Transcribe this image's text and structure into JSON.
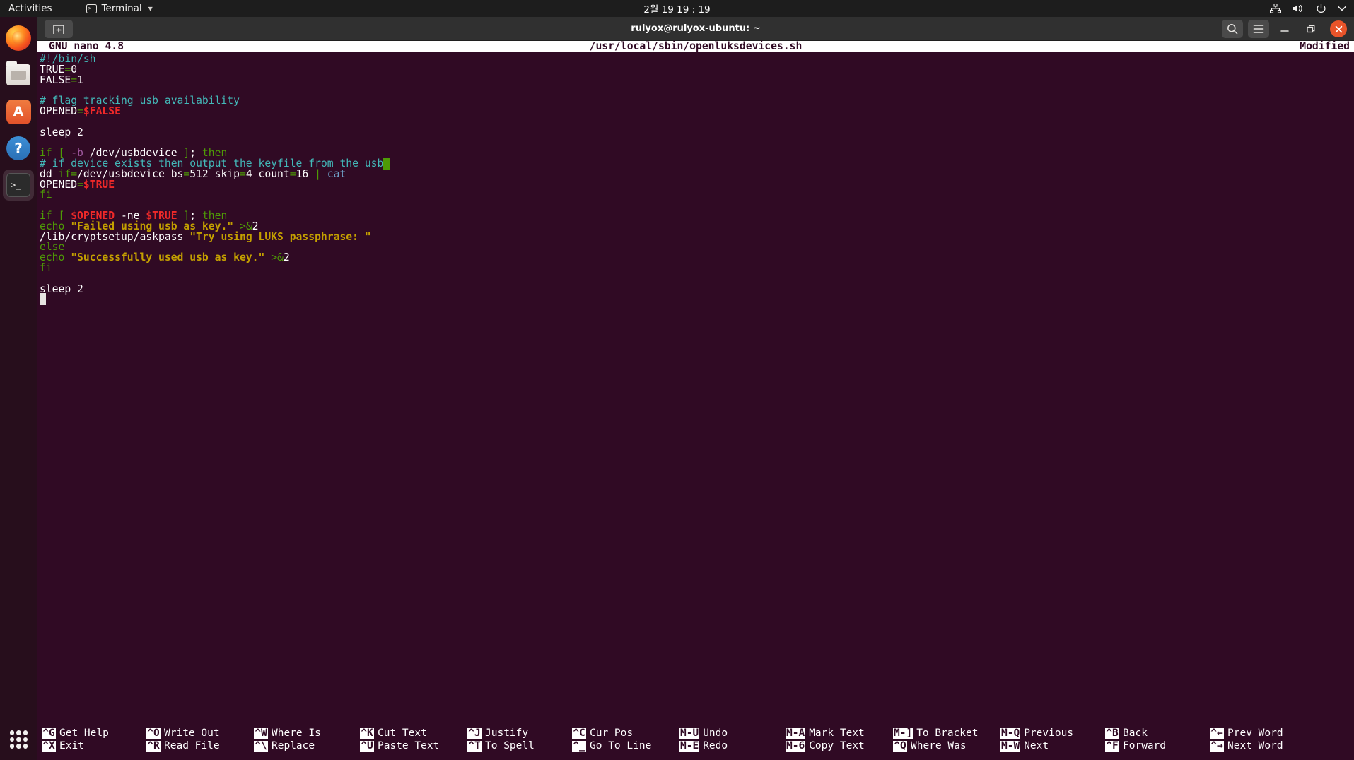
{
  "topbar": {
    "activities": "Activities",
    "app_name": "Terminal",
    "app_icon": "terminal-icon",
    "clock": "2월 19  19 : 19",
    "indicators": [
      "network-icon",
      "volume-icon",
      "power-icon",
      "chevron-down-icon"
    ]
  },
  "dock": {
    "items": [
      {
        "name": "firefox",
        "label": "Firefox"
      },
      {
        "name": "files",
        "label": "Files"
      },
      {
        "name": "software",
        "label": "Ubuntu Software"
      },
      {
        "name": "help",
        "label": "Help"
      },
      {
        "name": "terminal",
        "label": "Terminal"
      }
    ],
    "show_apps": "Show Applications"
  },
  "window": {
    "title": "rulyox@rulyox-ubuntu: ~",
    "new_tab_icon": "new-tab-icon",
    "controls": {
      "search": "search-icon",
      "menu": "hamburger-menu-icon",
      "minimize": "minimize-icon",
      "maximize": "maximize-icon",
      "close": "close-icon"
    }
  },
  "nano": {
    "version": "GNU nano 4.8",
    "filepath": "/usr/local/sbin/openluksdevices.sh",
    "status": "Modified",
    "lines": [
      [
        {
          "t": "#!/bin/sh",
          "c": "cmt"
        }
      ],
      [
        {
          "t": "TRUE",
          "c": "wht"
        },
        {
          "t": "=",
          "c": "eq"
        },
        {
          "t": "0",
          "c": "wht"
        }
      ],
      [
        {
          "t": "FALSE",
          "c": "wht"
        },
        {
          "t": "=",
          "c": "eq"
        },
        {
          "t": "1",
          "c": "wht"
        }
      ],
      [],
      [
        {
          "t": "# flag tracking usb availability",
          "c": "cmt"
        }
      ],
      [
        {
          "t": "OPENED",
          "c": "wht"
        },
        {
          "t": "=",
          "c": "eq"
        },
        {
          "t": "$FALSE",
          "c": "red"
        }
      ],
      [],
      [
        {
          "t": "sleep 2",
          "c": "wht"
        }
      ],
      [],
      [
        {
          "t": "if",
          "c": "grn"
        },
        {
          "t": " ",
          "c": "wht"
        },
        {
          "t": "[",
          "c": "grn"
        },
        {
          "t": " ",
          "c": "wht"
        },
        {
          "t": "-b",
          "c": "pur"
        },
        {
          "t": " /dev/usbdevice ",
          "c": "wht"
        },
        {
          "t": "]",
          "c": "grn"
        },
        {
          "t": "; ",
          "c": "wht"
        },
        {
          "t": "then",
          "c": "grn"
        }
      ],
      [
        {
          "t": "# if device exists then output the keyfile from the usb",
          "c": "cmt"
        },
        {
          "t": " ",
          "c": "cur-grn"
        }
      ],
      [
        {
          "t": "dd ",
          "c": "wht"
        },
        {
          "t": "if",
          "c": "grn"
        },
        {
          "t": "=",
          "c": "eq"
        },
        {
          "t": "/dev/usbdevice bs",
          "c": "wht"
        },
        {
          "t": "=",
          "c": "eq"
        },
        {
          "t": "512 skip",
          "c": "wht"
        },
        {
          "t": "=",
          "c": "eq"
        },
        {
          "t": "4 count",
          "c": "wht"
        },
        {
          "t": "=",
          "c": "eq"
        },
        {
          "t": "16 ",
          "c": "wht"
        },
        {
          "t": "|",
          "c": "grn"
        },
        {
          "t": " ",
          "c": "wht"
        },
        {
          "t": "cat",
          "c": "cyn"
        }
      ],
      [
        {
          "t": "OPENED",
          "c": "wht"
        },
        {
          "t": "=",
          "c": "eq"
        },
        {
          "t": "$TRUE",
          "c": "red"
        }
      ],
      [
        {
          "t": "fi",
          "c": "grn"
        }
      ],
      [],
      [
        {
          "t": "if",
          "c": "grn"
        },
        {
          "t": " ",
          "c": "wht"
        },
        {
          "t": "[",
          "c": "grn"
        },
        {
          "t": " ",
          "c": "wht"
        },
        {
          "t": "$OPENED",
          "c": "red"
        },
        {
          "t": " -ne ",
          "c": "wht"
        },
        {
          "t": "$TRUE",
          "c": "red"
        },
        {
          "t": " ",
          "c": "wht"
        },
        {
          "t": "]",
          "c": "grn"
        },
        {
          "t": "; ",
          "c": "wht"
        },
        {
          "t": "then",
          "c": "grn"
        }
      ],
      [
        {
          "t": "echo",
          "c": "grn"
        },
        {
          "t": " ",
          "c": "wht"
        },
        {
          "t": "\"Failed using usb as key.\"",
          "c": "yel"
        },
        {
          "t": " ",
          "c": "wht"
        },
        {
          "t": ">&",
          "c": "grn"
        },
        {
          "t": "2",
          "c": "wht"
        }
      ],
      [
        {
          "t": "/lib/cryptsetup/askpass ",
          "c": "wht"
        },
        {
          "t": "\"Try using LUKS passphrase: \"",
          "c": "yel"
        }
      ],
      [
        {
          "t": "else",
          "c": "grn"
        }
      ],
      [
        {
          "t": "echo",
          "c": "grn"
        },
        {
          "t": " ",
          "c": "wht"
        },
        {
          "t": "\"Successfully used usb as key.\"",
          "c": "yel"
        },
        {
          "t": " ",
          "c": "wht"
        },
        {
          "t": ">&",
          "c": "grn"
        },
        {
          "t": "2",
          "c": "wht"
        }
      ],
      [
        {
          "t": "fi",
          "c": "grn"
        }
      ],
      [],
      [
        {
          "t": "sleep 2",
          "c": "wht"
        }
      ],
      [
        {
          "t": " ",
          "c": "cur-wht"
        }
      ]
    ],
    "shortcuts": [
      [
        {
          "key": "^G",
          "label": "Get Help"
        },
        {
          "key": "^X",
          "label": "Exit"
        }
      ],
      [
        {
          "key": "^O",
          "label": "Write Out"
        },
        {
          "key": "^R",
          "label": "Read File"
        }
      ],
      [
        {
          "key": "^W",
          "label": "Where Is"
        },
        {
          "key": "^\\",
          "label": "Replace"
        }
      ],
      [
        {
          "key": "^K",
          "label": "Cut Text"
        },
        {
          "key": "^U",
          "label": "Paste Text"
        }
      ],
      [
        {
          "key": "^J",
          "label": "Justify"
        },
        {
          "key": "^T",
          "label": "To Spell"
        }
      ],
      [
        {
          "key": "^C",
          "label": "Cur Pos"
        },
        {
          "key": "^_",
          "label": "Go To Line"
        }
      ],
      [
        {
          "key": "M-U",
          "label": "Undo"
        },
        {
          "key": "M-E",
          "label": "Redo"
        }
      ],
      [
        {
          "key": "M-A",
          "label": "Mark Text"
        },
        {
          "key": "M-6",
          "label": "Copy Text"
        }
      ],
      [
        {
          "key": "M-]",
          "label": "To Bracket"
        },
        {
          "key": "^Q",
          "label": "Where Was"
        }
      ],
      [
        {
          "key": "M-Q",
          "label": "Previous"
        },
        {
          "key": "M-W",
          "label": "Next"
        }
      ],
      [
        {
          "key": "^B",
          "label": "Back"
        },
        {
          "key": "^F",
          "label": "Forward"
        }
      ],
      [
        {
          "key": "^←",
          "label": "Prev Word"
        },
        {
          "key": "^→",
          "label": "Next Word"
        }
      ]
    ]
  },
  "colors": {
    "terminal_bg": "#300a24",
    "accent": "#e95420",
    "topbar_bg": "#1d1d1d",
    "titlebar_bg": "#303030"
  }
}
